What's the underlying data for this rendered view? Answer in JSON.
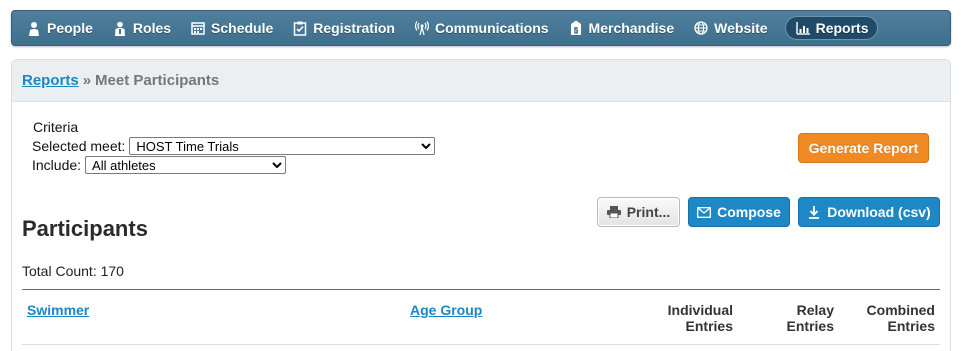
{
  "nav": {
    "items": [
      {
        "label": "People",
        "icon": "person-icon"
      },
      {
        "label": "Roles",
        "icon": "roles-icon"
      },
      {
        "label": "Schedule",
        "icon": "calendar-icon"
      },
      {
        "label": "Registration",
        "icon": "clipboard-check-icon"
      },
      {
        "label": "Communications",
        "icon": "broadcast-icon"
      },
      {
        "label": "Merchandise",
        "icon": "price-tag-icon"
      },
      {
        "label": "Website",
        "icon": "globe-icon"
      },
      {
        "label": "Reports",
        "icon": "bar-chart-icon",
        "active": true
      }
    ]
  },
  "breadcrumb": {
    "link": "Reports",
    "separator": "»",
    "current": "Meet Participants"
  },
  "criteria": {
    "title": "Criteria",
    "meet_label": "Selected meet:",
    "meet_value": "HOST Time Trials",
    "include_label": "Include:",
    "include_value": "All athletes"
  },
  "buttons": {
    "generate": "Generate Report",
    "print": "Print...",
    "compose": "Compose",
    "download": "Download (csv)"
  },
  "section": {
    "title": "Participants",
    "total_count": "Total Count: 170"
  },
  "table": {
    "headers": {
      "swimmer": "Swimmer",
      "age_group": "Age Group",
      "individual_1": "Individual",
      "individual_2": "Entries",
      "relay_1": "Relay",
      "relay_2": "Entries",
      "combined_1": "Combined",
      "combined_2": "Entries"
    }
  },
  "colors": {
    "nav_bg": "#4a7b98",
    "link": "#1b87c4",
    "orange_button": "#f08a24",
    "blue_button": "#1e88c7"
  }
}
